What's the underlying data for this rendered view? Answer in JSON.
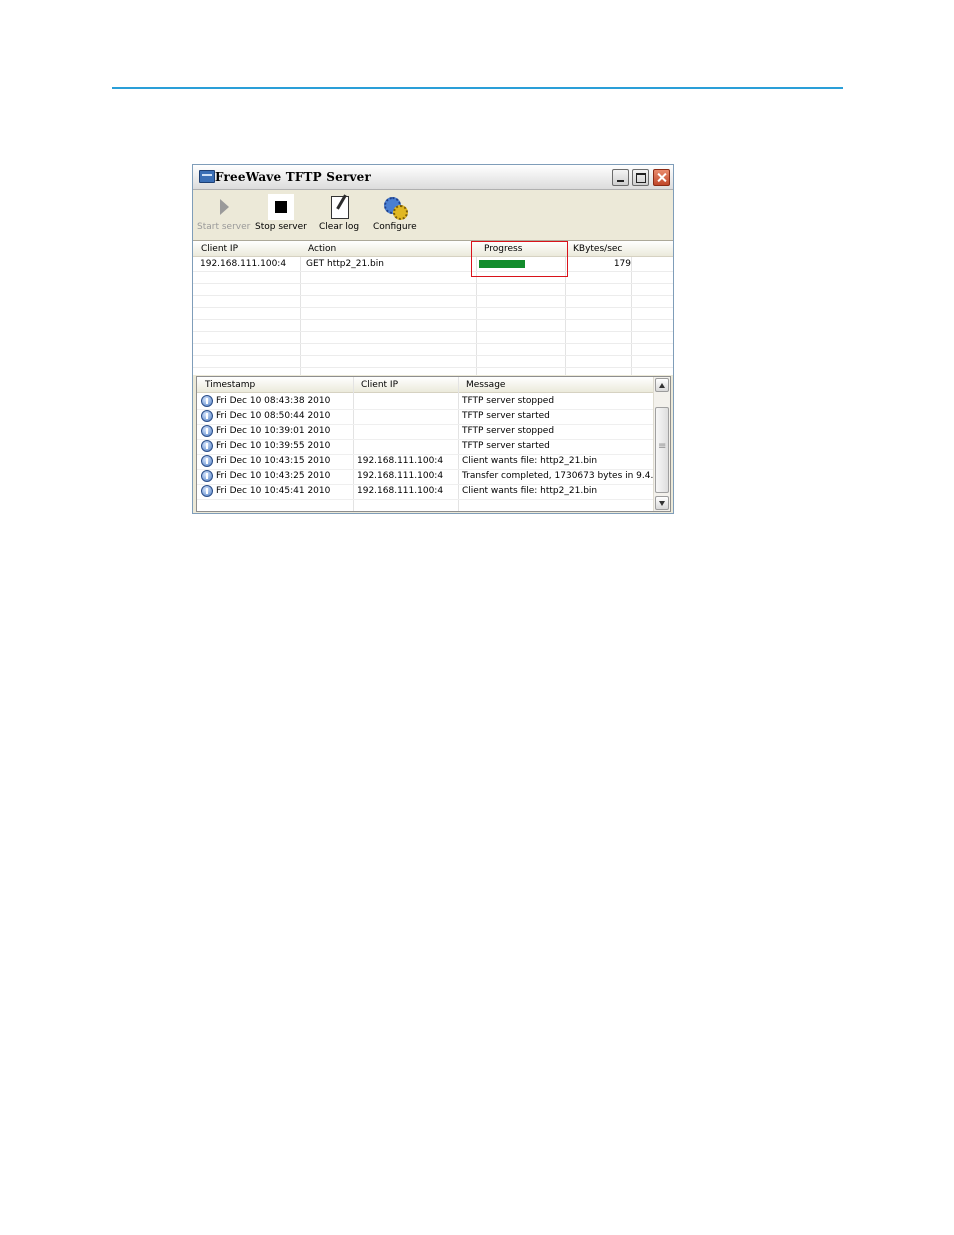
{
  "window": {
    "title": "FreeWave TFTP Server"
  },
  "toolbar": {
    "start_label": "Start server",
    "stop_label": "Stop server",
    "clear_label": "Clear log",
    "configure_label": "Configure"
  },
  "transfers": {
    "headers": [
      "Client IP",
      "Action",
      "Progress",
      "KBytes/sec"
    ],
    "rows": [
      {
        "client_ip": "192.168.111.100:4",
        "action": "GET http2_21.bin",
        "progress_fraction": 0.48,
        "kbytes_sec": "179"
      }
    ],
    "progress_color": "#128c2c",
    "highlight_color": "#d9121a"
  },
  "log": {
    "headers": [
      "Timestamp",
      "Client IP",
      "Message"
    ],
    "rows": [
      {
        "timestamp": "Fri Dec 10 08:43:38 2010",
        "client_ip": "",
        "message": "TFTP server stopped"
      },
      {
        "timestamp": "Fri Dec 10 08:50:44 2010",
        "client_ip": "",
        "message": "TFTP server started"
      },
      {
        "timestamp": "Fri Dec 10 10:39:01 2010",
        "client_ip": "",
        "message": "TFTP server stopped"
      },
      {
        "timestamp": "Fri Dec 10 10:39:55 2010",
        "client_ip": "",
        "message": "TFTP server started"
      },
      {
        "timestamp": "Fri Dec 10 10:43:15 2010",
        "client_ip": "192.168.111.100:4",
        "message": "Client wants file: http2_21.bin"
      },
      {
        "timestamp": "Fri Dec 10 10:43:25 2010",
        "client_ip": "192.168.111.100:4",
        "message": "Transfer completed, 1730673 bytes in 9.4..."
      },
      {
        "timestamp": "Fri Dec 10 10:45:41 2010",
        "client_ip": "192.168.111.100:4",
        "message": "Client wants file: http2_21.bin"
      }
    ]
  },
  "accent": "#2a9fd8"
}
